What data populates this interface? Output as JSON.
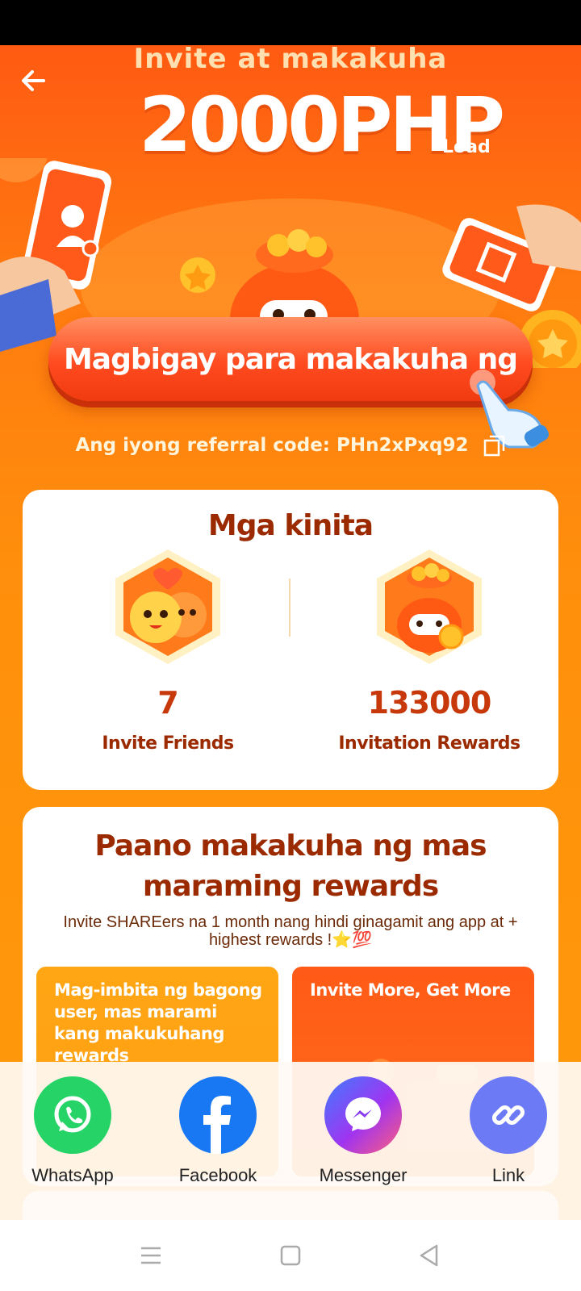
{
  "header": {
    "headline_small": "Invite at makakuha",
    "headline_amount": "2000PHP",
    "headline_unit": "Load"
  },
  "cta": {
    "label": "Magbigay para makakuha ng"
  },
  "referral": {
    "text": "Ang iyong referral code: PHn2xPxq92"
  },
  "earnings": {
    "title": "Mga kinita",
    "stats": [
      {
        "value": "7",
        "label": "Invite Friends"
      },
      {
        "value": "133000",
        "label": "Invitation Rewards"
      }
    ]
  },
  "how_to": {
    "title": "Paano makakuha ng mas maraming rewards",
    "subtitle": "Invite SHAREers na 1 month nang hindi ginagamit ang app at + highest rewards !⭐💯",
    "tips": [
      {
        "text": "Mag-imbita ng bagong user, mas marami kang makukuhang rewards"
      },
      {
        "text": "Invite More, Get More"
      }
    ]
  },
  "share": {
    "items": [
      {
        "label": "WhatsApp",
        "icon": "whatsapp-icon",
        "color": "#25d366"
      },
      {
        "label": "Facebook",
        "icon": "facebook-icon",
        "color": "#1877f2"
      },
      {
        "label": "Messenger",
        "icon": "messenger-icon",
        "color": "#a034f0"
      },
      {
        "label": "Link",
        "icon": "link-icon",
        "color": "#6c7bf5"
      }
    ]
  },
  "colors": {
    "accent_orange": "#ff7a10",
    "title_brown": "#9b2a00",
    "value_red": "#c7380a"
  }
}
